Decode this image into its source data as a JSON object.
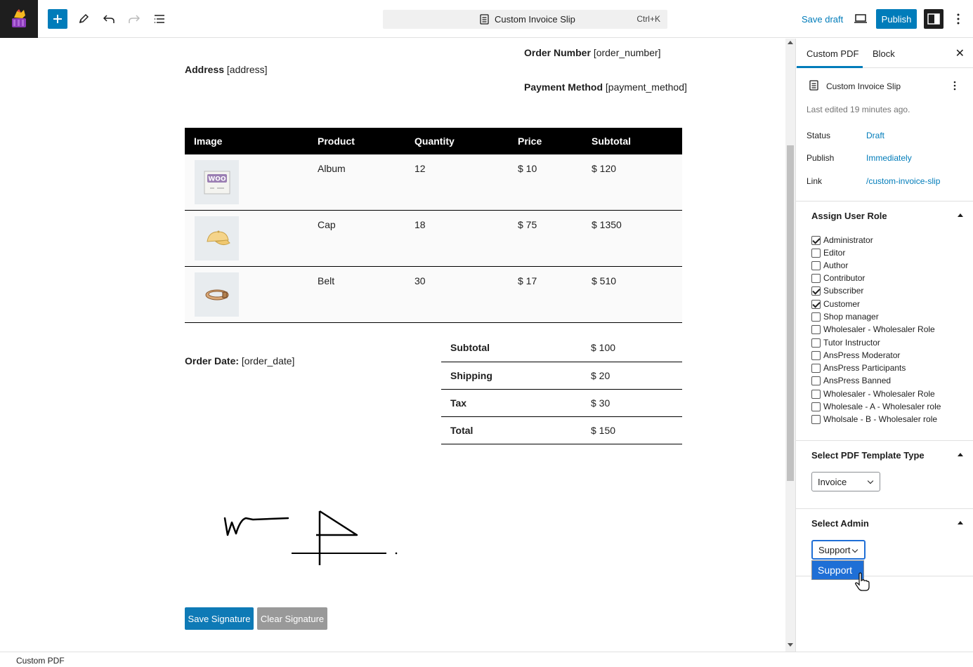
{
  "toolbar": {
    "document_title": "Custom Invoice Slip",
    "shortcut": "Ctrl+K",
    "save_draft": "Save draft",
    "publish": "Publish"
  },
  "document": {
    "order_number_label": "Order Number",
    "order_number_value": "[order_number]",
    "address_label": "Address",
    "address_value": "[address]",
    "payment_label": "Payment Method",
    "payment_value": "[payment_method]",
    "order_date_label": "Order Date:",
    "order_date_value": "[order_date]",
    "table": {
      "headers": [
        "Image",
        "Product",
        "Quantity",
        "Price",
        "Subtotal"
      ],
      "rows": [
        {
          "product": "Album",
          "quantity": "12",
          "price": "$ 10",
          "subtotal": "$ 120"
        },
        {
          "product": "Cap",
          "quantity": "18",
          "price": "$ 75",
          "subtotal": "$ 1350"
        },
        {
          "product": "Belt",
          "quantity": "30",
          "price": "$ 17",
          "subtotal": "$ 510"
        }
      ]
    },
    "totals": [
      {
        "label": "Subtotal",
        "value": "$ 100"
      },
      {
        "label": "Shipping",
        "value": "$ 20"
      },
      {
        "label": "Tax",
        "value": "$ 30"
      },
      {
        "label": "Total",
        "value": "$ 150"
      }
    ],
    "save_signature": "Save Signature",
    "clear_signature": "Clear Signature"
  },
  "sidebar": {
    "tab_custom_pdf": "Custom PDF",
    "tab_block": "Block",
    "post_title": "Custom Invoice Slip",
    "last_edited": "Last edited 19 minutes ago.",
    "status_label": "Status",
    "status_value": "Draft",
    "publish_label": "Publish",
    "publish_value": "Immediately",
    "link_label": "Link",
    "link_value": "/custom-invoice-slip",
    "assign_role_title": "Assign User Role",
    "roles": [
      {
        "label": "Administrator",
        "checked": true
      },
      {
        "label": "Editor",
        "checked": false
      },
      {
        "label": "Author",
        "checked": false
      },
      {
        "label": "Contributor",
        "checked": false
      },
      {
        "label": "Subscriber",
        "checked": true
      },
      {
        "label": "Customer",
        "checked": true
      },
      {
        "label": "Shop manager",
        "checked": false
      },
      {
        "label": "Wholesaler - Wholesaler Role",
        "checked": false
      },
      {
        "label": "Tutor Instructor",
        "checked": false
      },
      {
        "label": "AnsPress Moderator",
        "checked": false
      },
      {
        "label": "AnsPress Participants",
        "checked": false
      },
      {
        "label": "AnsPress Banned",
        "checked": false
      },
      {
        "label": "Wholesaler - Wholesaler Role",
        "checked": false
      },
      {
        "label": "Wholesale - A - Wholesaler role",
        "checked": false
      },
      {
        "label": "Wholsale - B - Wholesaler role",
        "checked": false
      }
    ],
    "template_type_title": "Select PDF Template Type",
    "template_type_value": "Invoice",
    "select_admin_title": "Select Admin",
    "select_admin_value": "Support",
    "select_admin_option": "Support"
  },
  "footer": {
    "breadcrumb": "Custom PDF"
  },
  "colors": {
    "accent": "#007cba",
    "header_bg": "#000000",
    "dropdown_highlight": "#1f6fd6"
  }
}
